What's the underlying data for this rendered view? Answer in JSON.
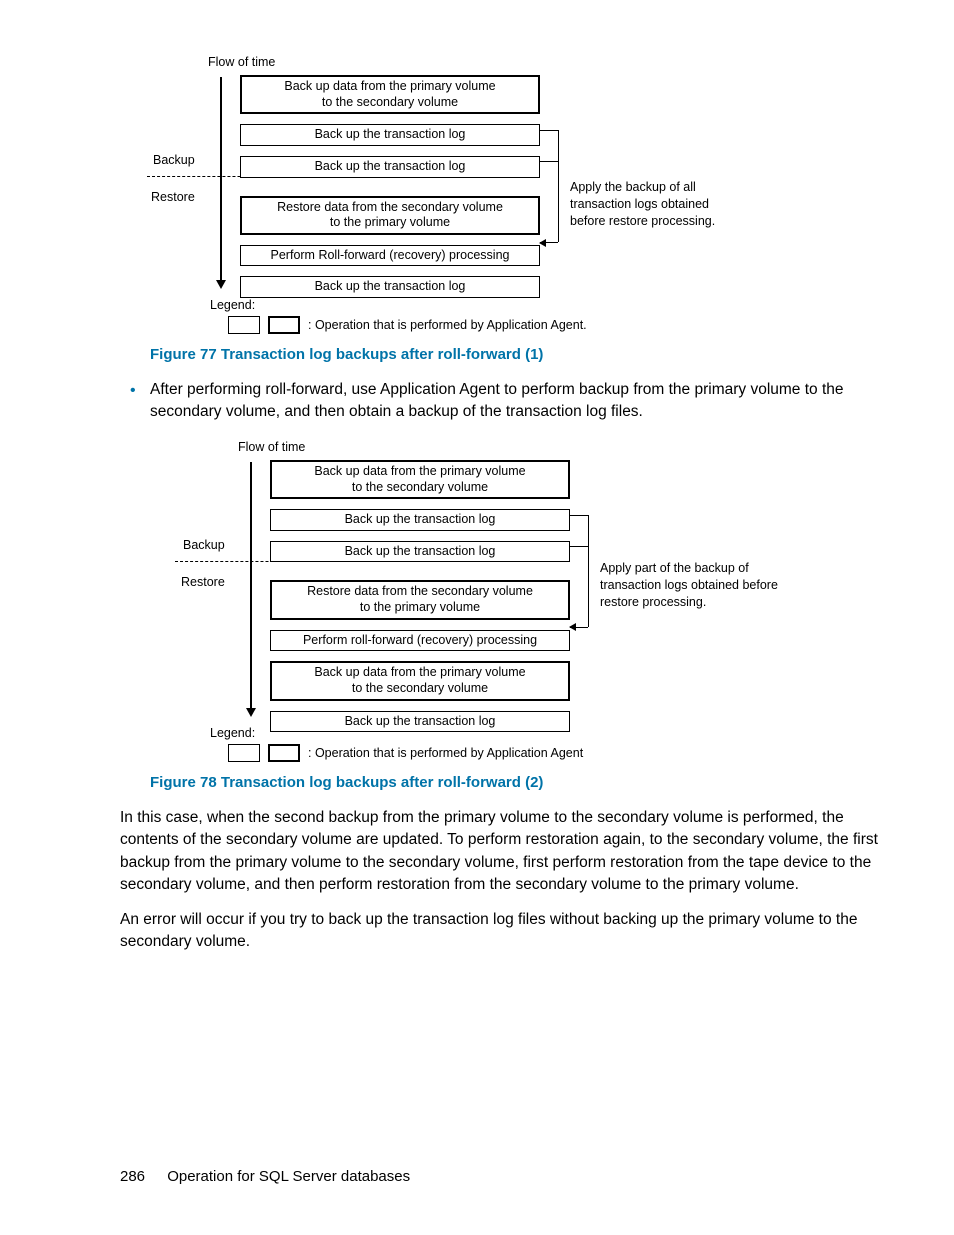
{
  "diagram1": {
    "flow_of_time": "Flow of time",
    "phase_backup": "Backup",
    "phase_restore": "Restore",
    "boxes": {
      "b0": "Back up data from the primary volume\nto the secondary volume",
      "b1": "Back up the transaction log",
      "b2": "Back up the transaction log",
      "b3": "Restore data from the secondary volume\nto the primary volume",
      "b4": "Perform Roll-forward (recovery) processing",
      "b5": "Back up the transaction log"
    },
    "annotation": "Apply the backup of all transaction logs obtained before restore processing.",
    "legend_label": "Legend:",
    "legend_text": ": Operation that is performed by Application Agent."
  },
  "caption77": "Figure 77 Transaction log backups after roll-forward (1)",
  "bullet1": "After performing roll-forward, use Application Agent to perform backup from the primary volume to the secondary volume, and then obtain a backup of the transaction log files.",
  "diagram2": {
    "flow_of_time": "Flow of time",
    "phase_backup": "Backup",
    "phase_restore": "Restore",
    "boxes": {
      "b0": "Back up data from the primary volume\nto the secondary volume",
      "b1": "Back up the transaction log",
      "b2": "Back up the transaction log",
      "b3": "Restore data from the secondary volume\nto the primary volume",
      "b4": "Perform roll-forward (recovery) processing",
      "b5": "Back up data from the primary volume\nto the secondary volume",
      "b6": "Back up the transaction log"
    },
    "annotation": "Apply part of the backup of transaction logs obtained before restore processing.",
    "legend_label": "Legend:",
    "legend_text": ": Operation that is performed by Application Agent"
  },
  "caption78": "Figure 78 Transaction log backups after roll-forward (2)",
  "para1": "In this case, when the second backup from the primary volume to the secondary volume is performed, the contents of the secondary volume are updated. To perform restoration again, to the secondary volume, the first backup from the primary volume to the secondary volume, first perform restoration from the tape device to the secondary volume, and then perform restoration from the secondary volume to the primary volume.",
  "para2": "An error will occur if you try to back up the transaction log files without backing up the primary volume to the secondary volume.",
  "footer": {
    "page": "286",
    "title": "Operation for SQL Server databases"
  }
}
